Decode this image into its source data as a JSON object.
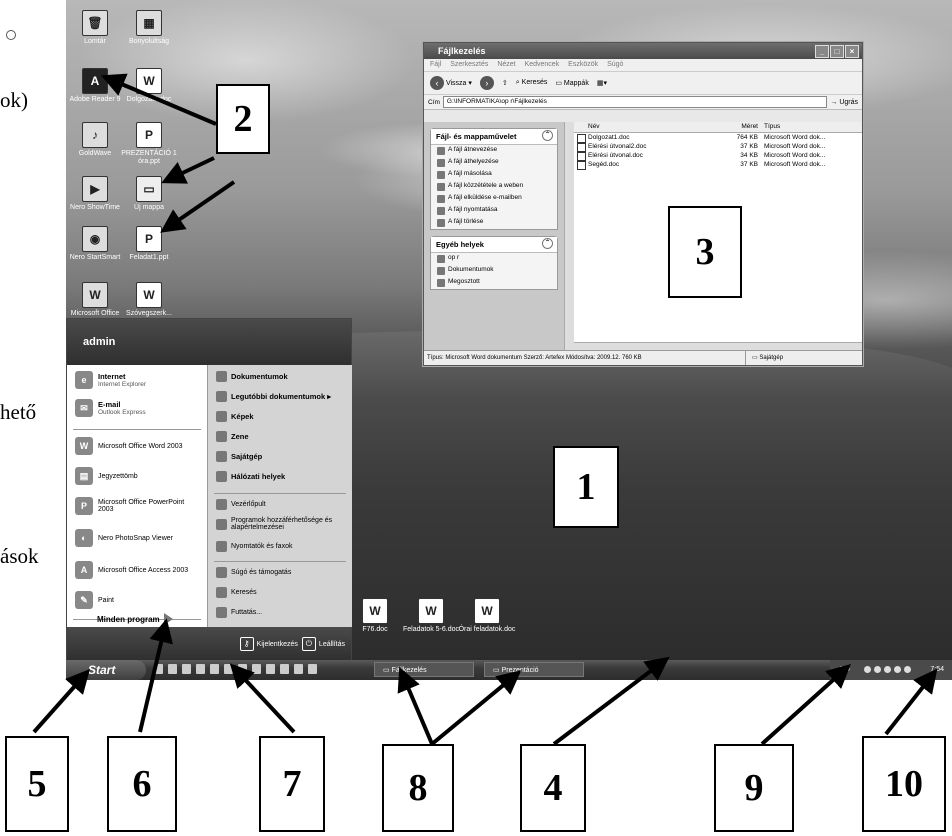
{
  "margin_text": [
    "ok)",
    "hető",
    "ások"
  ],
  "desktop_icons": [
    {
      "label": "Lomtár",
      "glyph": "🗑"
    },
    {
      "label": "Bonyolultság",
      "glyph": "▦"
    },
    {
      "label": "Adobe Reader 9",
      "glyph": "A"
    },
    {
      "label": "Dolgozat1.doc",
      "glyph": "W"
    },
    {
      "label": "GoldWave",
      "glyph": "♪"
    },
    {
      "label": "PREZENTÁCIÓ 1 óra.ppt",
      "glyph": "P"
    },
    {
      "label": "Nero ShowTime",
      "glyph": "▶"
    },
    {
      "label": "Új mappa",
      "glyph": "▭"
    },
    {
      "label": "Nero StartSmart",
      "glyph": "◉"
    },
    {
      "label": "Feladat1.ppt",
      "glyph": "P"
    },
    {
      "label": "Microsoft Office",
      "glyph": "W"
    },
    {
      "label": "Szóvegszerk...",
      "glyph": "W"
    }
  ],
  "bottom_icons": [
    {
      "label": "F76.doc"
    },
    {
      "label": "Feladatok 5-6.doc"
    },
    {
      "label": "Órai feladatok.doc"
    }
  ],
  "explorer": {
    "title": "Fájlkezelés",
    "menu": [
      "Fájl",
      "Szerkesztés",
      "Nézet",
      "Kedvencek",
      "Eszközök",
      "Súgó"
    ],
    "back": "Vissza",
    "search": "Keresés",
    "folders": "Mappák",
    "address_label": "Cím",
    "address": "G:\\INFORMATIKA\\op r\\Fájlkezelés",
    "go": "Ugrás",
    "tasks_title": "Fájl- és mappaművelet",
    "tasks": [
      "A fájl átnevezése",
      "A fájl áthelyezése",
      "A fájl másolása",
      "A fájl közzététele a weben",
      "A fájl elküldése e-mailben",
      "A fájl nyomtatása",
      "A fájl törlése"
    ],
    "other_title": "Egyéb helyek",
    "other": [
      "op r",
      "Dokumentumok",
      "Megosztott"
    ],
    "cols": {
      "name": "Név",
      "size": "Méret",
      "type": "Típus"
    },
    "files": [
      {
        "name": "Dolgozat1.doc",
        "size": "764 KB",
        "type": "Microsoft Word dok..."
      },
      {
        "name": "Elérési útvonal2.doc",
        "size": "37 KB",
        "type": "Microsoft Word dok..."
      },
      {
        "name": "Elérési útvonal.doc",
        "size": "34 KB",
        "type": "Microsoft Word dok..."
      },
      {
        "name": "Segéd.doc",
        "size": "37 KB",
        "type": "Microsoft Word dok..."
      }
    ],
    "status": "Típus: Microsoft Word dokumentum Szerző: Artefex Módosítva: 2009.12. 760 KB",
    "status_right": "Sajátgép"
  },
  "startmenu": {
    "user": "admin",
    "left": [
      {
        "title": "Internet",
        "sub": "Internet Explorer",
        "bold": true
      },
      {
        "title": "E-mail",
        "sub": "Outlook Express",
        "bold": true
      },
      {
        "title": "Microsoft Office Word 2003",
        "sub": "",
        "bold": false
      },
      {
        "title": "Jegyzettömb",
        "sub": "",
        "bold": false
      },
      {
        "title": "Microsoft Office PowerPoint 2003",
        "sub": "",
        "bold": false
      },
      {
        "title": "Nero PhotoSnap Viewer",
        "sub": "",
        "bold": false
      },
      {
        "title": "Microsoft Office Access 2003",
        "sub": "",
        "bold": false
      },
      {
        "title": "Paint",
        "sub": "",
        "bold": false
      }
    ],
    "all_programs": "Minden program",
    "right": [
      {
        "label": "Dokumentumok",
        "bold": true
      },
      {
        "label": "Legutóbbi dokumentumok ▸",
        "bold": true
      },
      {
        "label": "Képek",
        "bold": true
      },
      {
        "label": "Zene",
        "bold": true
      },
      {
        "label": "Sajátgép",
        "bold": true
      },
      {
        "label": "Hálózati helyek",
        "bold": true
      },
      {
        "label": "Vezérlőpult",
        "bold": false
      },
      {
        "label": "Programok hozzáférhetősége és alapértelmezései",
        "bold": false
      },
      {
        "label": "Nyomtatók és faxok",
        "bold": false
      },
      {
        "label": "Súgó és támogatás",
        "bold": false
      },
      {
        "label": "Keresés",
        "bold": false
      },
      {
        "label": "Futtatás...",
        "bold": false
      }
    ],
    "logoff": "Kijelentkezés",
    "shutdown": "Leállítás"
  },
  "taskbar": {
    "start": "Start",
    "tasks": [
      "Fájlkezelés",
      "Prezentáció"
    ],
    "lang": "HU",
    "clock": "7:54"
  },
  "labels": [
    "1",
    "2",
    "3",
    "4",
    "5",
    "6",
    "7",
    "8",
    "9",
    "10"
  ]
}
